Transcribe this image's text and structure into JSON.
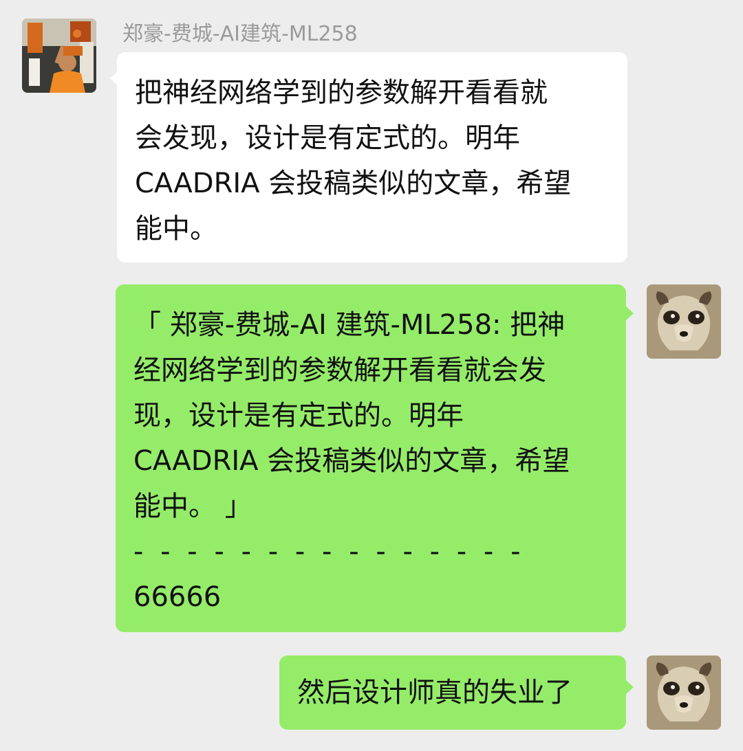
{
  "chat": {
    "incoming": {
      "sender_name": "郑豪-费城-AI建筑-ML258",
      "avatar_icon": "person-photo-avatar",
      "lines": [
        "把神经网络学到的参数解开看看就",
        "会发现，设计是有定式的。明年",
        "CAADRIA 会投稿类似的文章，希望",
        "能中。"
      ]
    },
    "reply_quote": {
      "avatar_icon": "meerkat-avatar",
      "lines": [
        "「 郑豪-费城-AI 建筑-ML258: 把神",
        "经网络学到的参数解开看看就会发",
        "现，设计是有定式的。明年",
        "CAADRIA 会投稿类似的文章，希望",
        "能中。 」",
        "- - - - - - - - - - - - - - -",
        "66666"
      ]
    },
    "reply_last": {
      "avatar_icon": "meerkat-avatar",
      "text": "然后设计师真的失业了"
    }
  },
  "colors": {
    "background": "#ededed",
    "incoming_bubble": "#ffffff",
    "outgoing_bubble": "#95ec69",
    "sender_name": "#9a9a9a"
  }
}
